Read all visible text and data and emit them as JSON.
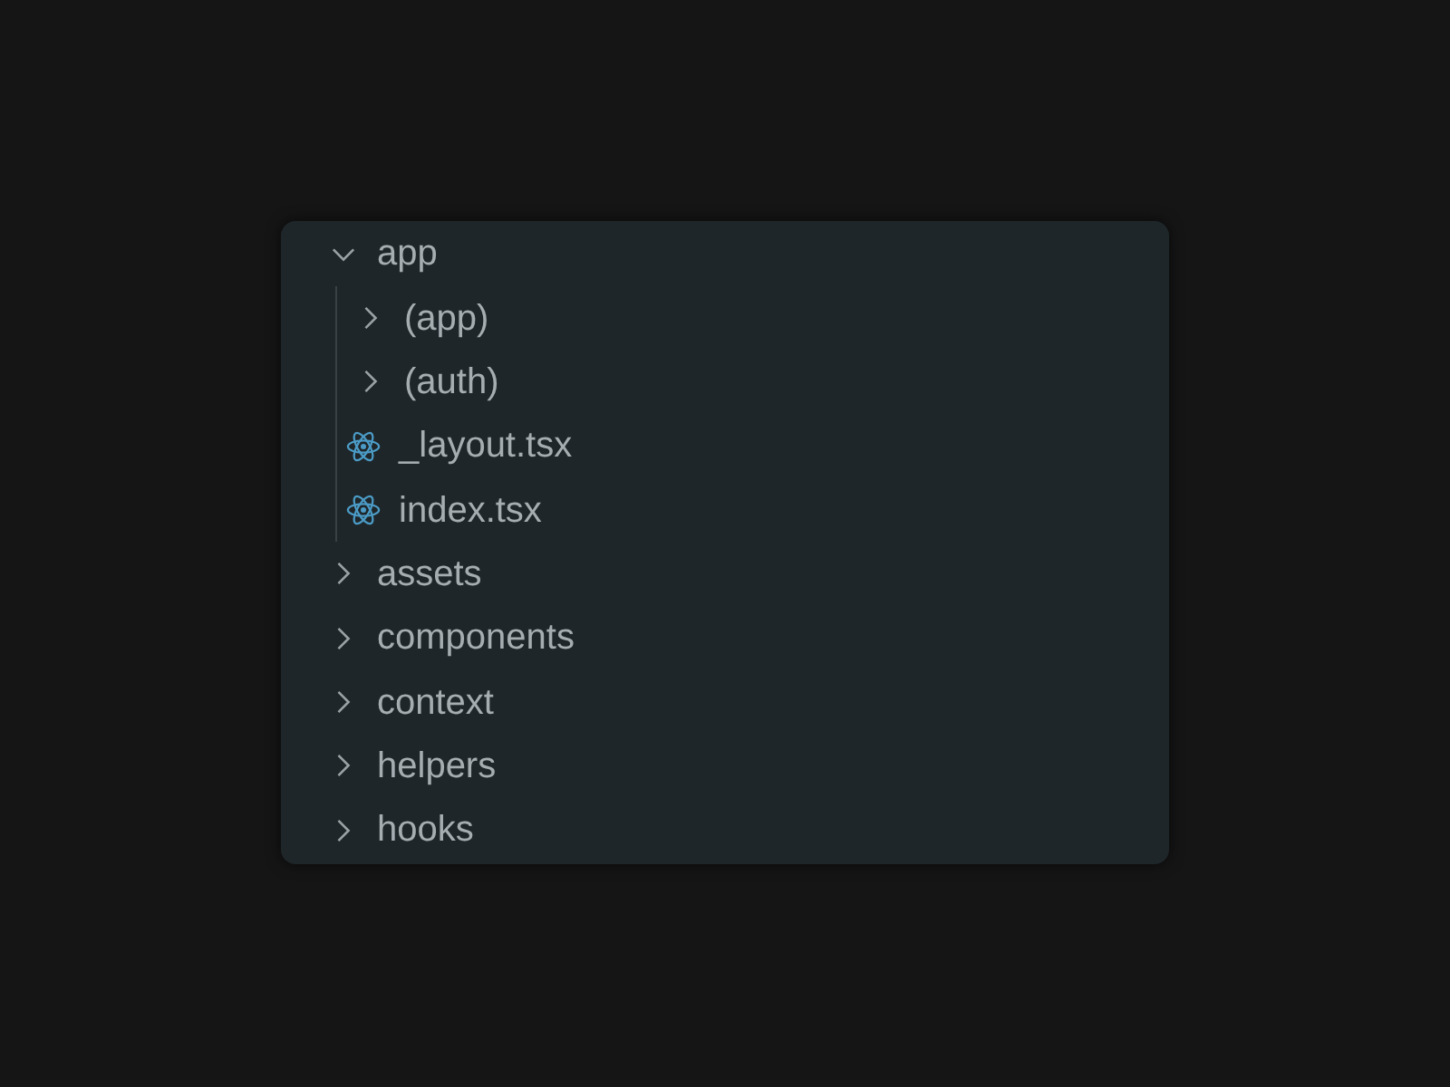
{
  "tree": [
    {
      "kind": "folder",
      "label": "app",
      "expanded": true,
      "children": [
        {
          "kind": "folder",
          "label": "(app)",
          "expanded": false
        },
        {
          "kind": "folder",
          "label": "(auth)",
          "expanded": false
        },
        {
          "kind": "file",
          "label": "_layout.tsx"
        },
        {
          "kind": "file",
          "label": "index.tsx"
        }
      ]
    },
    {
      "kind": "folder",
      "label": "assets",
      "expanded": false
    },
    {
      "kind": "folder",
      "label": "components",
      "expanded": false
    },
    {
      "kind": "folder",
      "label": "context",
      "expanded": false
    },
    {
      "kind": "folder",
      "label": "helpers",
      "expanded": false
    },
    {
      "kind": "folder",
      "label": "hooks",
      "expanded": false
    }
  ]
}
